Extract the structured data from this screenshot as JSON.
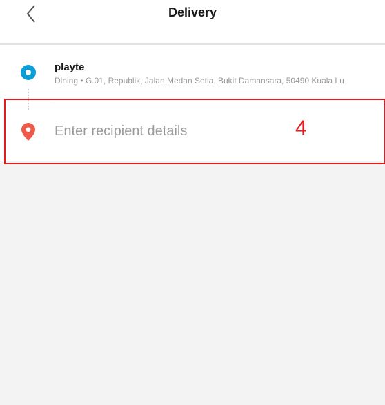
{
  "header": {
    "title": "Delivery",
    "back_icon": "chevron-left-icon"
  },
  "pickup": {
    "name": "playte",
    "address": "Dining • G.01, Republik, Jalan Medan Setia, Bukit Damansara, 50490 Kuala Lu",
    "icon": "pickup-dot-icon",
    "color": "#0a9ed8"
  },
  "dropoff": {
    "placeholder": "Enter recipient details",
    "value": "",
    "icon": "map-pin-icon",
    "color": "#ee5a4a"
  },
  "annotation": {
    "label": "4",
    "color": "#e31b1b"
  }
}
